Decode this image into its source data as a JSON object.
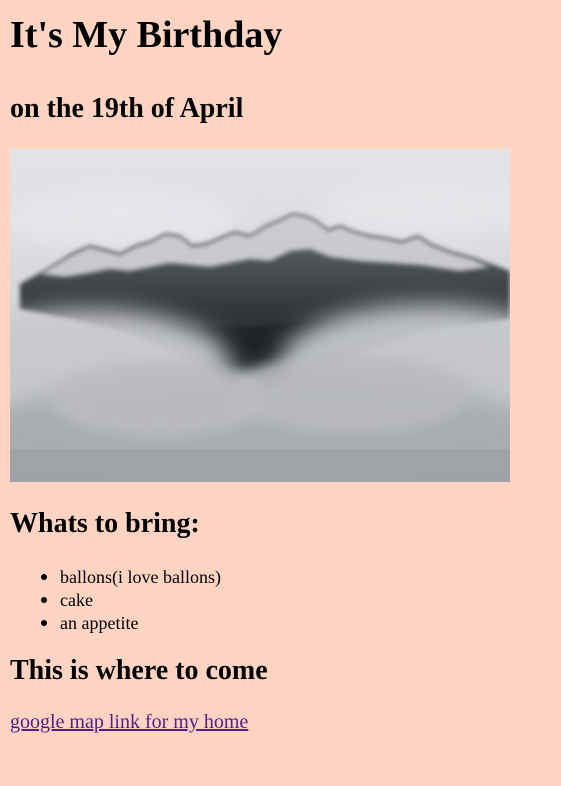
{
  "title": "It's My Birthday",
  "subtitle": "on the 19th of April",
  "photo": {
    "alt": "mountain peak above clouds",
    "colors": {
      "sky_top": "#E4E4E8",
      "sky_bottom": "#C9CACF",
      "fog": "#B4B6BA",
      "rock_dark": "#2B2F33",
      "rock_mid": "#5B5F64",
      "snow": "#E6E7EA"
    }
  },
  "bring": {
    "heading": "Whats to bring:",
    "items": [
      "ballons(i love ballons)",
      "cake",
      "an appetite"
    ]
  },
  "where": {
    "heading": "This is where to come",
    "link_text": "google map link for my home"
  },
  "colors": {
    "background": "#FFD4C3",
    "link": "#551A8B"
  }
}
